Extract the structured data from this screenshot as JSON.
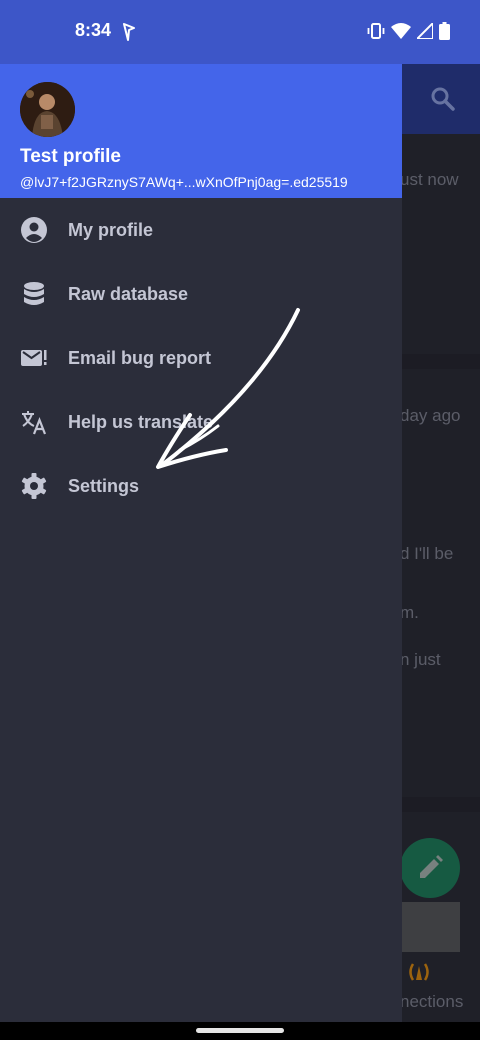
{
  "status_bar": {
    "time": "8:34",
    "icons": [
      "navigation-icon",
      "vibrate-icon",
      "wifi-icon",
      "signal-icon",
      "battery-icon"
    ]
  },
  "background": {
    "texts": [
      "ust now",
      "day ago",
      "d I'll be",
      "m.",
      "n just",
      "nections"
    ],
    "accent_fab": "#1f7d5c",
    "connection_icon_color": "#d98a14"
  },
  "drawer": {
    "header_color": "#4465ea",
    "profile": {
      "name": "Test profile",
      "id": "@lvJ7+f2JGRznyS7AWq+...wXnOfPnj0ag=.ed25519"
    },
    "items": [
      {
        "label": "My profile",
        "icon": "account-circle-icon"
      },
      {
        "label": "Raw database",
        "icon": "database-icon"
      },
      {
        "label": "Email bug report",
        "icon": "email-alert-icon"
      },
      {
        "label": "Help us translate",
        "icon": "translate-icon"
      },
      {
        "label": "Settings",
        "icon": "gear-icon"
      }
    ]
  },
  "colors": {
    "status_bar": "#3d56c8",
    "drawer_bg": "#2b2d3a",
    "menu_text": "#c4c6d4"
  }
}
